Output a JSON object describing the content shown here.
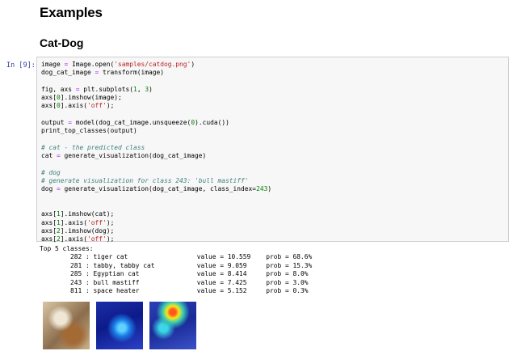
{
  "headings": {
    "examples": "Examples",
    "section": "Cat-Dog"
  },
  "cell": {
    "prompt": "In [9]:",
    "code_lines": [
      "image = Image.open('samples/catdog.png')",
      "dog_cat_image = transform(image)",
      "",
      "fig, axs = plt.subplots(1, 3)",
      "axs[0].imshow(image);",
      "axs[0].axis('off');",
      "",
      "output = model(dog_cat_image.unsqueeze(0).cuda())",
      "print_top_classes(output)",
      "",
      "# cat - the predicted class",
      "cat = generate_visualization(dog_cat_image)",
      "",
      "# dog",
      "# generate visualization for class 243: 'bull mastiff'",
      "dog = generate_visualization(dog_cat_image, class_index=243)",
      "",
      "",
      "axs[1].imshow(cat);",
      "axs[1].axis('off');",
      "axs[2].imshow(dog);",
      "axs[2].axis('off');"
    ]
  },
  "output": {
    "header": "Top 5 classes:",
    "rows": [
      "        282 : tiger cat                  value = 10.559    prob = 68.6%",
      "        281 : tabby, tabby cat           value = 9.059     prob = 15.3%",
      "        285 : Egyptian cat               value = 8.414     prob = 8.0%",
      "        243 : bull mastiff               value = 7.425     prob = 3.0%",
      "        811 : space heater               value = 5.152     prob = 0.3%"
    ]
  },
  "thumbnails": [
    "original-image",
    "cat-heatmap",
    "dog-heatmap"
  ]
}
